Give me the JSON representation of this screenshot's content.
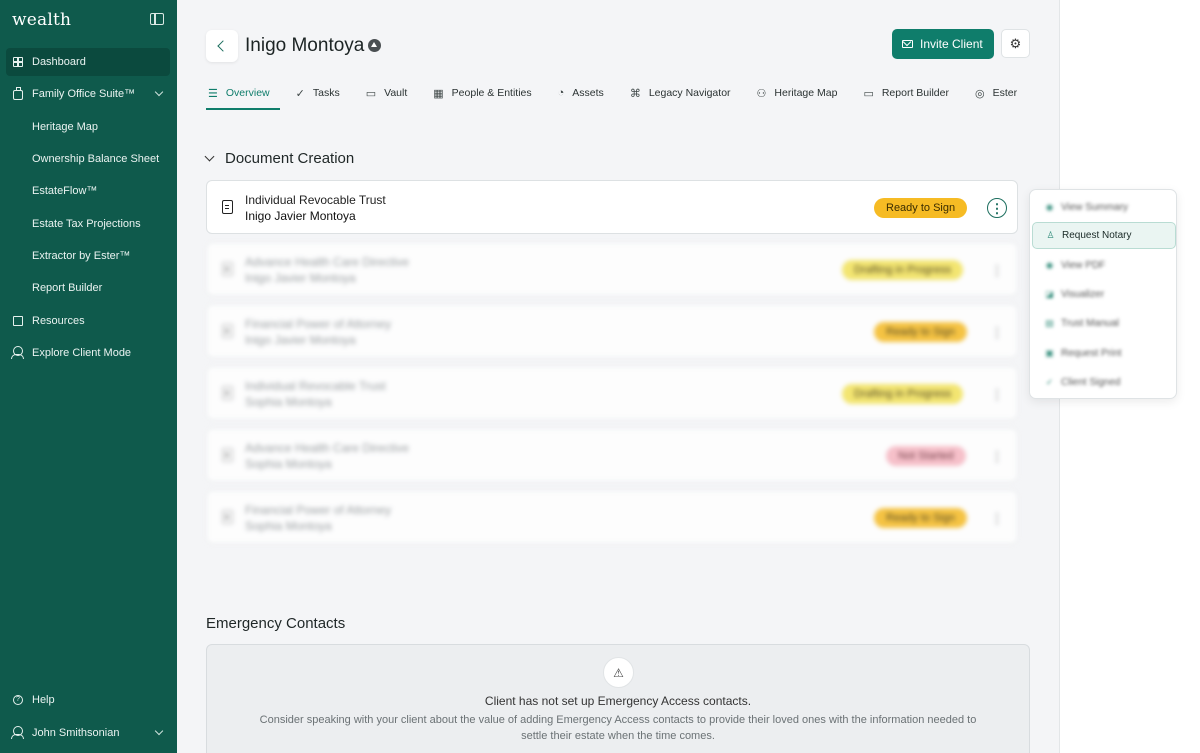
{
  "brand": "wealth",
  "sidebar": {
    "items": [
      {
        "label": "Dashboard",
        "icon": "grid-icon"
      },
      {
        "label": "Family Office Suite™",
        "icon": "briefcase-icon"
      },
      {
        "label": "Heritage Map"
      },
      {
        "label": "Ownership Balance Sheet"
      },
      {
        "label": "EstateFlow™"
      },
      {
        "label": "Estate Tax Projections"
      },
      {
        "label": "Extractor by Ester™"
      },
      {
        "label": "Report Builder"
      },
      {
        "label": "Resources",
        "icon": "document-icon"
      },
      {
        "label": "Explore Client Mode",
        "icon": "users-icon"
      }
    ],
    "help": "Help",
    "user": "John Smithsonian"
  },
  "header": {
    "client_name": "Inigo Montoya",
    "invite_label": "Invite Client"
  },
  "tabs": [
    {
      "label": "Overview",
      "icon": "☰"
    },
    {
      "label": "Tasks",
      "icon": "✓"
    },
    {
      "label": "Vault",
      "icon": "▭"
    },
    {
      "label": "People & Entities",
      "icon": "▦"
    },
    {
      "label": "Assets",
      "icon": "◔"
    },
    {
      "label": "Legacy Navigator",
      "icon": "⌘"
    },
    {
      "label": "Heritage Map",
      "icon": "⚇"
    },
    {
      "label": "Report Builder",
      "icon": "▭"
    },
    {
      "label": "Ester",
      "icon": "◎"
    }
  ],
  "documents": {
    "section_title": "Document Creation",
    "items": [
      {
        "title": "Individual Revocable Trust",
        "owner": "Inigo Javier Montoya",
        "status": "Ready to Sign"
      },
      {
        "title": "Advance Health Care Directive",
        "owner": "Inigo Javier Montoya",
        "status": "Drafting in Progress"
      },
      {
        "title": "Financial Power of Attorney",
        "owner": "Inigo Javier Montoya",
        "status": "Ready to Sign"
      },
      {
        "title": "Individual Revocable Trust",
        "owner": "Sophia Montoya",
        "status": "Drafting in Progress"
      },
      {
        "title": "Advance Health Care Directive",
        "owner": "Sophia Montoya",
        "status": "Not Started"
      },
      {
        "title": "Financial Power of Attorney",
        "owner": "Sophia Montoya",
        "status": "Ready to Sign"
      }
    ]
  },
  "menu": {
    "items": [
      {
        "label": "View Summary",
        "icon": "eye-icon"
      },
      {
        "label": "Request Notary",
        "icon": "stamp-icon"
      },
      {
        "label": "View PDF",
        "icon": "eye-icon"
      },
      {
        "label": "Visualizer",
        "icon": "chart-icon"
      },
      {
        "label": "Trust Manual",
        "icon": "document-icon"
      },
      {
        "label": "Request Print",
        "icon": "printer-icon"
      },
      {
        "label": "Client Signed",
        "icon": "check-icon"
      }
    ]
  },
  "emergency": {
    "title": "Emergency Contacts",
    "empty_title": "Client has not set up Emergency Access contacts.",
    "empty_body": "Consider speaking with your client about the value of adding Emergency Access contacts to provide their loved ones with the information needed to settle their estate when the time comes."
  },
  "colors": {
    "sidebar": "#0f5a4c",
    "accent": "#0f7d6b",
    "ready": "#f6bb24",
    "drafting": "#f3e35a",
    "not_started": "#f7b7c2"
  }
}
